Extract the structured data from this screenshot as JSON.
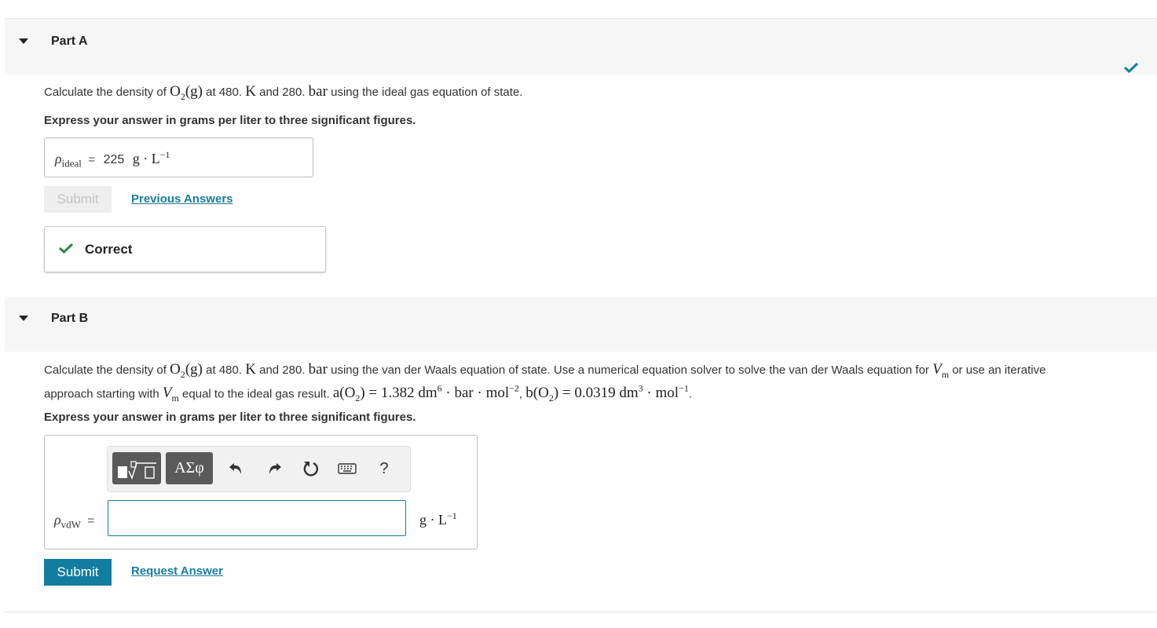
{
  "part_a": {
    "title": "Part A",
    "question": {
      "t1": "Calculate the density of ",
      "species_base": "O",
      "species_sub": "2",
      "species_state": "(g)",
      "t2": " at 480. ",
      "unit_k": "K",
      "t3": " and 280. ",
      "unit_bar": "bar",
      "t4": " using the ideal gas equation of state."
    },
    "instruction": "Express your answer in grams per liter to three significant figures.",
    "answer": {
      "symbol": "ρ",
      "subscript": "ideal",
      "equals": "=",
      "value": "225",
      "unit_base": "g · L",
      "unit_exp": "−1"
    },
    "submit_label": "Submit",
    "link_label": "Previous Answers",
    "feedback_label": "Correct"
  },
  "part_b": {
    "title": "Part B",
    "question": {
      "t1": "Calculate the density of ",
      "species_base": "O",
      "species_sub": "2",
      "species_state": "(g)",
      "t2": " at 480. ",
      "unit_k": "K",
      "t3": " and 280. ",
      "unit_bar": "bar",
      "t4": " using the van der Waals equation of state. Use a numerical equation solver to solve the van der Waals equation for ",
      "vm_base": "V",
      "vm_sub": "m",
      "t5": " or use an iterative",
      "t6": "approach starting with ",
      "t7": " equal to the ideal gas result. ",
      "a_expr": "a(O",
      "a_sub": "2",
      "a_rest": ") = 1.382 dm",
      "a_exp1": "6",
      "a_mid": " · bar · mol",
      "a_exp2": "−2",
      "sep": ", ",
      "b_expr": "b(O",
      "b_sub": "2",
      "b_rest": ") = 0.0319 dm",
      "b_exp1": "3",
      "b_mid": " · mol",
      "b_exp2": "−1",
      "end": "."
    },
    "instruction": "Express your answer in grams per liter to three significant figures.",
    "answer": {
      "symbol": "ρ",
      "subscript": "vdW",
      "equals": "=",
      "value": "",
      "unit_base": "g · L",
      "unit_exp": "−1"
    },
    "toolbar": {
      "greek_label": "ΑΣφ",
      "help_label": "?"
    },
    "submit_label": "Submit",
    "link_label": "Request Answer"
  },
  "colors": {
    "accent": "#127e9f",
    "success": "#2e8b3e",
    "link": "#1a7ca0"
  }
}
